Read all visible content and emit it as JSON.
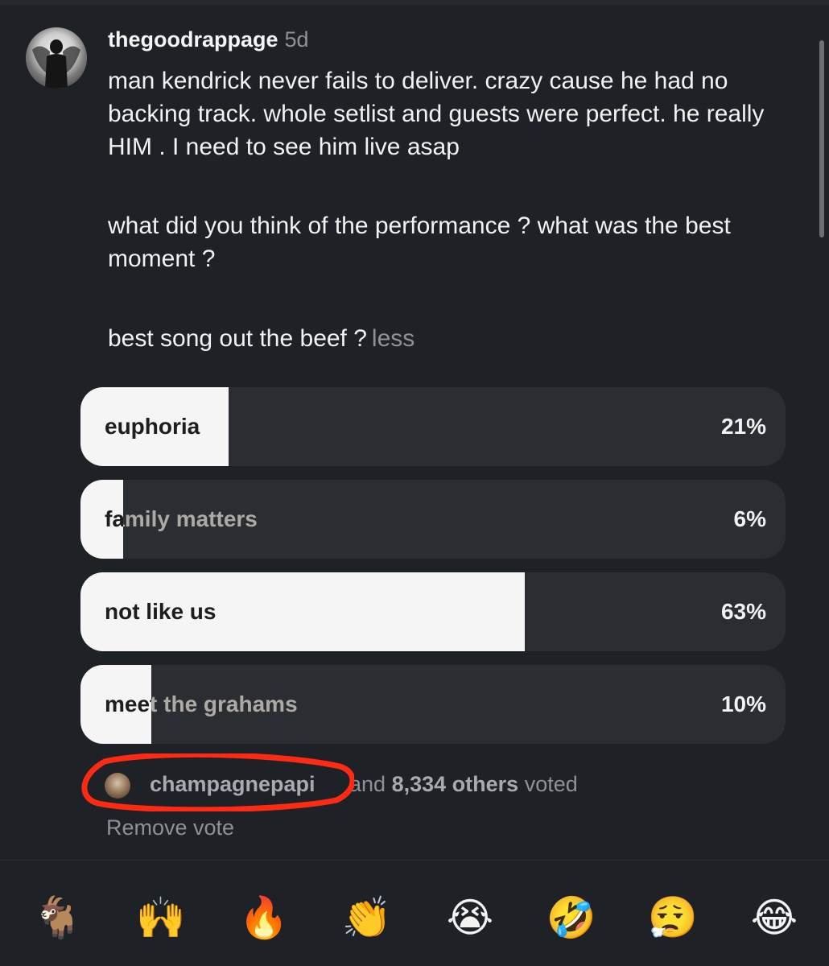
{
  "comment": {
    "username": "thegoodrappage",
    "timestamp": "5d",
    "paragraphs": [
      "man kendrick never fails to deliver. crazy cause he had no backing track. whole setlist and guests were perfect. he really HIM . I need to see him live asap",
      "what did you think of the performance ? what was the best moment ?",
      "best song out the beef ?"
    ],
    "less_label": "less"
  },
  "poll": {
    "options": [
      {
        "label": "euphoria",
        "percent_text": "21%",
        "percent": 21
      },
      {
        "label": "family matters",
        "percent_text": "6%",
        "percent": 6
      },
      {
        "label": "not like us",
        "percent_text": "63%",
        "percent": 63
      },
      {
        "label": "meet the grahams",
        "percent_text": "10%",
        "percent": 10
      }
    ],
    "voted_by": "champagnepapi",
    "voted_rest_prefix": "and",
    "voted_count": "8,334 others",
    "voted_suffix": "voted",
    "remove_vote_label": "Remove vote"
  },
  "reactions": [
    {
      "icon": "goat-icon",
      "glyph": "🐐"
    },
    {
      "icon": "raising-hands-icon",
      "glyph": "🙌"
    },
    {
      "icon": "fire-icon",
      "glyph": "🔥"
    },
    {
      "icon": "clapping-hands-icon",
      "glyph": "👏"
    },
    {
      "icon": "loudly-crying-face-icon",
      "glyph": "😭"
    },
    {
      "icon": "rolling-on-floor-laughing-icon",
      "glyph": "🤣"
    },
    {
      "icon": "face-exhaling-icon",
      "glyph": "😮‍💨"
    },
    {
      "icon": "face-with-tears-of-joy-icon",
      "glyph": "😂"
    }
  ],
  "colors": {
    "background": "#1e2125",
    "poll_track": "#2a2d31",
    "poll_fill": "#f5f5f5",
    "muted_text": "#8e9196",
    "highlight_circle": "#ff2a14"
  }
}
